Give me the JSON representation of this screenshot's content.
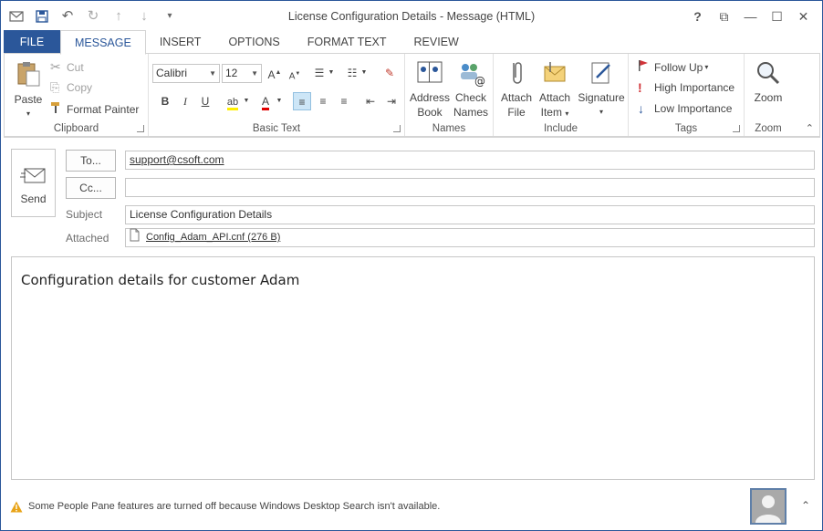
{
  "window": {
    "title": "License Configuration Details - Message (HTML)",
    "controls": [
      "?",
      "⧉",
      "—",
      "☐",
      "✕"
    ]
  },
  "tabs": [
    "FILE",
    "MESSAGE",
    "INSERT",
    "OPTIONS",
    "FORMAT TEXT",
    "REVIEW"
  ],
  "ribbon": {
    "clipboard": {
      "label": "Clipboard",
      "paste": "Paste",
      "cut": "Cut",
      "copy": "Copy",
      "format_painter": "Format Painter"
    },
    "basic_text": {
      "label": "Basic Text",
      "font": "Calibri",
      "size": "12"
    },
    "names": {
      "label": "Names",
      "address_book_1": "Address",
      "address_book_2": "Book",
      "check_names_1": "Check",
      "check_names_2": "Names"
    },
    "include": {
      "label": "Include",
      "attach_file_1": "Attach",
      "attach_file_2": "File",
      "attach_item_1": "Attach",
      "attach_item_2": "Item",
      "signature": "Signature"
    },
    "tags": {
      "label": "Tags",
      "follow_up": "Follow Up",
      "high": "High Importance",
      "low": "Low Importance"
    },
    "zoom": {
      "label": "Zoom",
      "zoom": "Zoom"
    }
  },
  "compose": {
    "send": "Send",
    "to_button": "To...",
    "cc_button": "Cc...",
    "to_value": "support@csoft.com",
    "cc_value": "",
    "subject_label": "Subject",
    "subject_value": "License Configuration Details",
    "attached_label": "Attached",
    "attachment": "Config_Adam_API.cnf (276 B)",
    "body": "Configuration details for customer Adam"
  },
  "status": {
    "message": "Some People Pane features are turned off because Windows Desktop Search isn't available."
  },
  "colors": {
    "accent": "#2b579a",
    "warning": "#e8a317"
  }
}
